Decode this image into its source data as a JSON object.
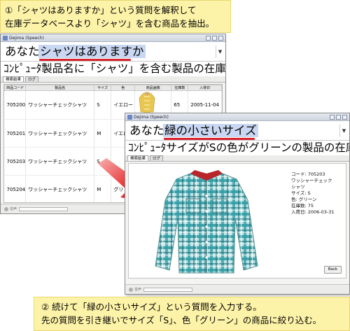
{
  "caption_top": {
    "line1": "①「シャツはありますか」という質問を解釈して",
    "line2": "在庫データベースより「シャツ」を含む商品を抽出。"
  },
  "caption_bottom": {
    "line1": "② 続けて「緑の小さいサイズ」という質問を入力する。",
    "line2": "先の質問を引き継いでサイズ「S」、色「グリーン」の商品に絞り込む。"
  },
  "window1": {
    "title": "Dejima (Speech)",
    "query_label": "あなた",
    "query_value": "シャツはありますか",
    "response": "ｺﾝﾋﾟｭｰﾀ製品名に「シャツ」を含む製品の在庫を検",
    "tabs": [
      "検索結果",
      "ログ"
    ],
    "columns": [
      "商品コード",
      "製品名",
      "サイズ",
      "色",
      "商品画像",
      "在庫数",
      "入荷日"
    ],
    "rows": [
      {
        "code": "705200",
        "name": "ワッシャーチェックシャツ",
        "size": "S",
        "color": "イエロー",
        "stock": "65",
        "date": "2005-11-04"
      },
      {
        "code": "705201",
        "name": "ワッシャーチェックシャツ",
        "size": "M",
        "color": "イエロー",
        "stock": "",
        "date": ""
      },
      {
        "code": "705203",
        "name": "ワッシャーチェックシャツ",
        "size": "S",
        "color": "",
        "stock": "",
        "date": ""
      },
      {
        "code": "705204",
        "name": "ワッシャーチェックシャツ",
        "size": "M",
        "color": "グリ",
        "stock": "",
        "date": ""
      }
    ],
    "status_label": "音声"
  },
  "window2": {
    "title": "Dejima (Speech)",
    "query_label": "あなた",
    "query_value": "緑の小さいサイズ",
    "response": "ｺﾝﾋﾟｭｰﾀサイズがSの色がグリーンの製品の在庫を",
    "tabs": [
      "検索結果",
      "ログ"
    ],
    "detail": [
      "コード: 705203",
      "ワッシャーチェック",
      "シャツ",
      "サイズ: S",
      "色: グリーン",
      "在庫数: 75",
      "入荷日: 2006-03-31"
    ],
    "back_label": "Back",
    "status_label": "音声"
  },
  "colors": {
    "caption_bg": "#fdf3a8",
    "highlight": "#c9d7f2",
    "underline": "#d9232d",
    "arrow": "#e32222"
  }
}
